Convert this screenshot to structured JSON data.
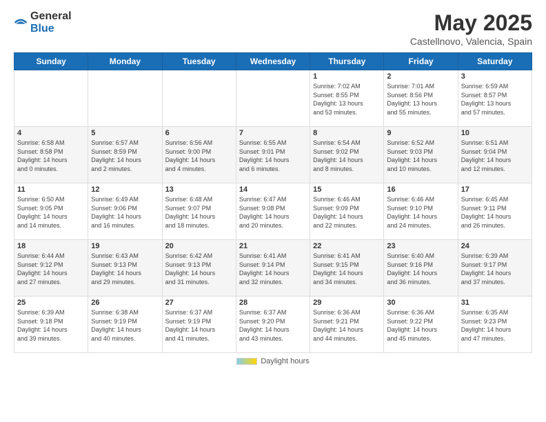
{
  "header": {
    "logo_general": "General",
    "logo_blue": "Blue",
    "month_title": "May 2025",
    "location": "Castellnovo, Valencia, Spain"
  },
  "days_of_week": [
    "Sunday",
    "Monday",
    "Tuesday",
    "Wednesday",
    "Thursday",
    "Friday",
    "Saturday"
  ],
  "weeks": [
    [
      {
        "num": "",
        "info": ""
      },
      {
        "num": "",
        "info": ""
      },
      {
        "num": "",
        "info": ""
      },
      {
        "num": "",
        "info": ""
      },
      {
        "num": "1",
        "info": "Sunrise: 7:02 AM\nSunset: 8:55 PM\nDaylight: 13 hours\nand 53 minutes."
      },
      {
        "num": "2",
        "info": "Sunrise: 7:01 AM\nSunset: 8:56 PM\nDaylight: 13 hours\nand 55 minutes."
      },
      {
        "num": "3",
        "info": "Sunrise: 6:59 AM\nSunset: 8:57 PM\nDaylight: 13 hours\nand 57 minutes."
      }
    ],
    [
      {
        "num": "4",
        "info": "Sunrise: 6:58 AM\nSunset: 8:58 PM\nDaylight: 14 hours\nand 0 minutes."
      },
      {
        "num": "5",
        "info": "Sunrise: 6:57 AM\nSunset: 8:59 PM\nDaylight: 14 hours\nand 2 minutes."
      },
      {
        "num": "6",
        "info": "Sunrise: 6:56 AM\nSunset: 9:00 PM\nDaylight: 14 hours\nand 4 minutes."
      },
      {
        "num": "7",
        "info": "Sunrise: 6:55 AM\nSunset: 9:01 PM\nDaylight: 14 hours\nand 6 minutes."
      },
      {
        "num": "8",
        "info": "Sunrise: 6:54 AM\nSunset: 9:02 PM\nDaylight: 14 hours\nand 8 minutes."
      },
      {
        "num": "9",
        "info": "Sunrise: 6:52 AM\nSunset: 9:03 PM\nDaylight: 14 hours\nand 10 minutes."
      },
      {
        "num": "10",
        "info": "Sunrise: 6:51 AM\nSunset: 9:04 PM\nDaylight: 14 hours\nand 12 minutes."
      }
    ],
    [
      {
        "num": "11",
        "info": "Sunrise: 6:50 AM\nSunset: 9:05 PM\nDaylight: 14 hours\nand 14 minutes."
      },
      {
        "num": "12",
        "info": "Sunrise: 6:49 AM\nSunset: 9:06 PM\nDaylight: 14 hours\nand 16 minutes."
      },
      {
        "num": "13",
        "info": "Sunrise: 6:48 AM\nSunset: 9:07 PM\nDaylight: 14 hours\nand 18 minutes."
      },
      {
        "num": "14",
        "info": "Sunrise: 6:47 AM\nSunset: 9:08 PM\nDaylight: 14 hours\nand 20 minutes."
      },
      {
        "num": "15",
        "info": "Sunrise: 6:46 AM\nSunset: 9:09 PM\nDaylight: 14 hours\nand 22 minutes."
      },
      {
        "num": "16",
        "info": "Sunrise: 6:46 AM\nSunset: 9:10 PM\nDaylight: 14 hours\nand 24 minutes."
      },
      {
        "num": "17",
        "info": "Sunrise: 6:45 AM\nSunset: 9:11 PM\nDaylight: 14 hours\nand 26 minutes."
      }
    ],
    [
      {
        "num": "18",
        "info": "Sunrise: 6:44 AM\nSunset: 9:12 PM\nDaylight: 14 hours\nand 27 minutes."
      },
      {
        "num": "19",
        "info": "Sunrise: 6:43 AM\nSunset: 9:13 PM\nDaylight: 14 hours\nand 29 minutes."
      },
      {
        "num": "20",
        "info": "Sunrise: 6:42 AM\nSunset: 9:13 PM\nDaylight: 14 hours\nand 31 minutes."
      },
      {
        "num": "21",
        "info": "Sunrise: 6:41 AM\nSunset: 9:14 PM\nDaylight: 14 hours\nand 32 minutes."
      },
      {
        "num": "22",
        "info": "Sunrise: 6:41 AM\nSunset: 9:15 PM\nDaylight: 14 hours\nand 34 minutes."
      },
      {
        "num": "23",
        "info": "Sunrise: 6:40 AM\nSunset: 9:16 PM\nDaylight: 14 hours\nand 36 minutes."
      },
      {
        "num": "24",
        "info": "Sunrise: 6:39 AM\nSunset: 9:17 PM\nDaylight: 14 hours\nand 37 minutes."
      }
    ],
    [
      {
        "num": "25",
        "info": "Sunrise: 6:39 AM\nSunset: 9:18 PM\nDaylight: 14 hours\nand 39 minutes."
      },
      {
        "num": "26",
        "info": "Sunrise: 6:38 AM\nSunset: 9:19 PM\nDaylight: 14 hours\nand 40 minutes."
      },
      {
        "num": "27",
        "info": "Sunrise: 6:37 AM\nSunset: 9:19 PM\nDaylight: 14 hours\nand 41 minutes."
      },
      {
        "num": "28",
        "info": "Sunrise: 6:37 AM\nSunset: 9:20 PM\nDaylight: 14 hours\nand 43 minutes."
      },
      {
        "num": "29",
        "info": "Sunrise: 6:36 AM\nSunset: 9:21 PM\nDaylight: 14 hours\nand 44 minutes."
      },
      {
        "num": "30",
        "info": "Sunrise: 6:36 AM\nSunset: 9:22 PM\nDaylight: 14 hours\nand 45 minutes."
      },
      {
        "num": "31",
        "info": "Sunrise: 6:35 AM\nSunset: 9:23 PM\nDaylight: 14 hours\nand 47 minutes."
      }
    ]
  ],
  "footer": {
    "daylight_label": "Daylight hours"
  }
}
